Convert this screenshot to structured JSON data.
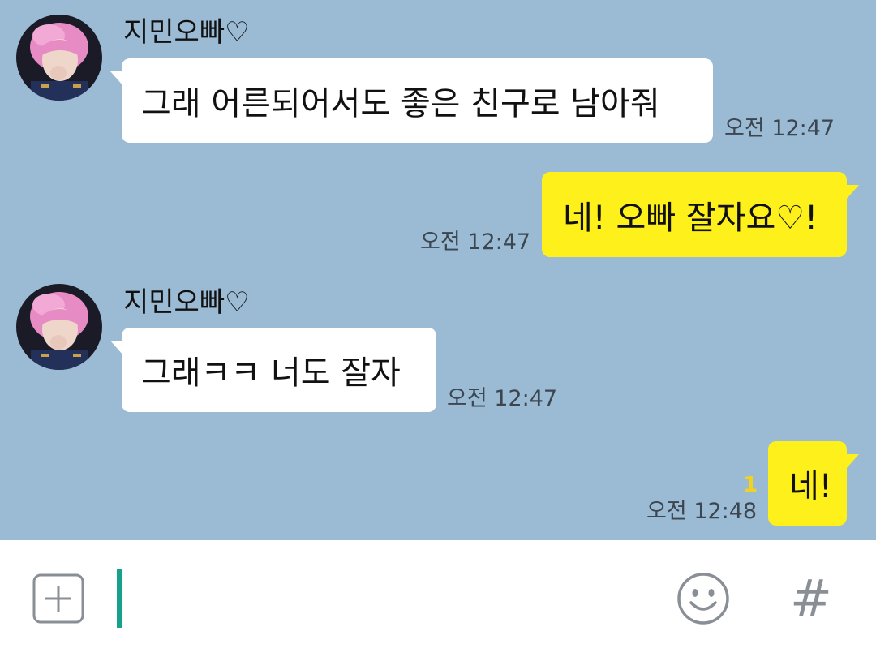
{
  "messages": [
    {
      "sender": "지민오빠♡",
      "text": "그래 어른되어서도 좋은 친구로 남아줘",
      "time": "오전 12:47",
      "direction": "incoming"
    },
    {
      "text": "네! 오빠 잘자요♡!",
      "time": "오전 12:47",
      "direction": "outgoing"
    },
    {
      "sender": "지민오빠♡",
      "text": "그래ㅋㅋ 너도 잘자",
      "time": "오전 12:47",
      "direction": "incoming"
    },
    {
      "text": "네!",
      "time": "오전 12:48",
      "unread_count": "1",
      "direction": "outgoing"
    }
  ],
  "input_bar": {
    "plus_icon": "plus-icon",
    "emoji_icon": "smiley-icon",
    "hash_symbol": "#"
  },
  "colors": {
    "chat_background": "#9bbbd4",
    "outgoing_bubble": "#fef01b",
    "incoming_bubble": "#ffffff",
    "cursor": "#17a08a",
    "unread": "#f2d21c"
  }
}
